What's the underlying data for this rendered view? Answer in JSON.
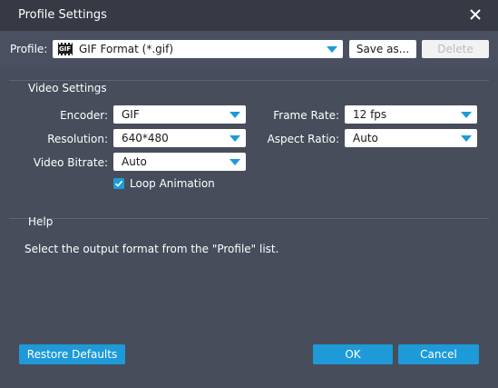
{
  "window": {
    "title": "Profile Settings"
  },
  "profile": {
    "label": "Profile:",
    "value": "GIF Format (*.gif)",
    "icon_text": "GIF",
    "save_as_label": "Save as...",
    "delete_label": "Delete"
  },
  "video_settings": {
    "title": "Video Settings",
    "encoder": {
      "label": "Encoder:",
      "value": "GIF"
    },
    "resolution": {
      "label": "Resolution:",
      "value": "640*480"
    },
    "video_bitrate": {
      "label": "Video Bitrate:",
      "value": "Auto"
    },
    "frame_rate": {
      "label": "Frame Rate:",
      "value": "12 fps"
    },
    "aspect_ratio": {
      "label": "Aspect Ratio:",
      "value": "Auto"
    },
    "loop_animation": {
      "label": "Loop Animation",
      "checked": true
    }
  },
  "help": {
    "title": "Help",
    "text": "Select the output format from the \"Profile\" list."
  },
  "footer": {
    "restore_label": "Restore Defaults",
    "ok_label": "OK",
    "cancel_label": "Cancel"
  },
  "colors": {
    "accent": "#1e9ad8",
    "titlebar": "#353a45",
    "background": "#474d5b"
  }
}
